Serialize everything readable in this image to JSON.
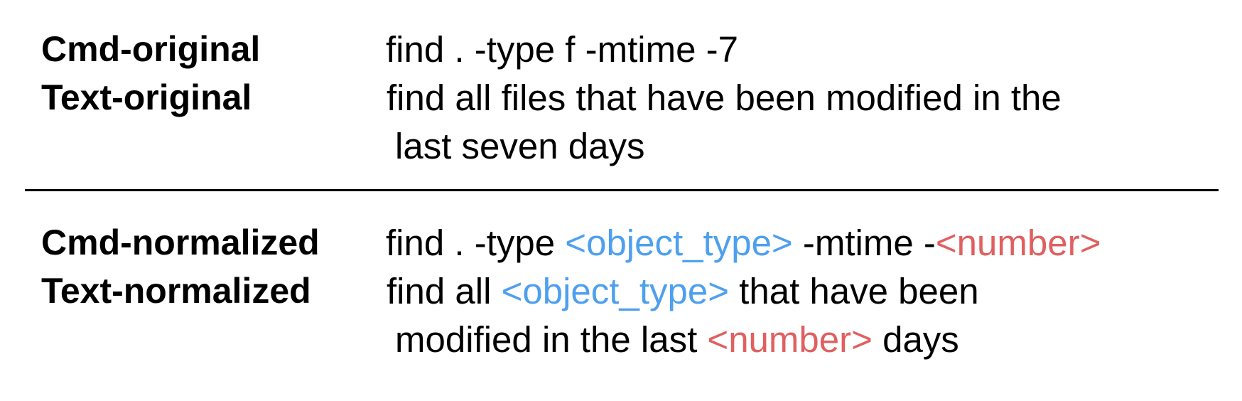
{
  "colors": {
    "placeholder_object_type": "#4ea0ee",
    "placeholder_number": "#e06060",
    "divider": "#000000"
  },
  "original": {
    "cmd_label": "Cmd-original",
    "cmd_value": "find . -type f -mtime -7",
    "text_label": "Text-original",
    "text_line1": "find all files that have been modified in the",
    "text_line2": "last seven days"
  },
  "normalized": {
    "cmd_label": "Cmd-normalized",
    "cmd_parts": {
      "p1": "find . -type ",
      "p2": "<object_type>",
      "p3": " -mtime -",
      "p4": "<number>"
    },
    "text_label": "Text-normalized",
    "text_line1_parts": {
      "p1": "find all ",
      "p2": "<object_type>",
      "p3": " that have been"
    },
    "text_line2_parts": {
      "p1": "modified in the last ",
      "p2": "<number>",
      "p3": " days"
    }
  }
}
